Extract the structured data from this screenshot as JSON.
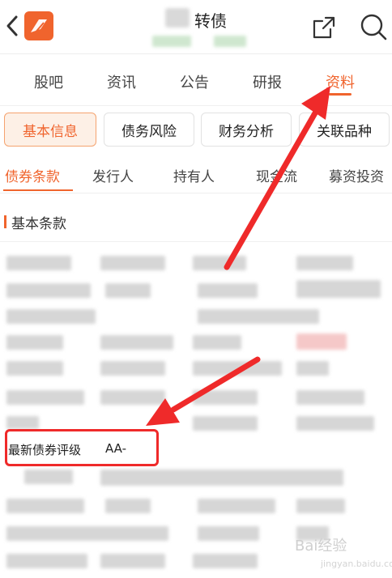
{
  "header": {
    "title_suffix": "转债",
    "icons": {
      "back": "chevron-left-icon",
      "logo": "app-logo-icon",
      "share": "share-icon",
      "search": "search-icon"
    }
  },
  "tabs_primary": [
    {
      "label": "股吧",
      "active": false
    },
    {
      "label": "资讯",
      "active": false
    },
    {
      "label": "公告",
      "active": false
    },
    {
      "label": "研报",
      "active": false
    },
    {
      "label": "资料",
      "active": true
    }
  ],
  "chips": [
    {
      "label": "基本信息",
      "active": true
    },
    {
      "label": "债务风险",
      "active": false
    },
    {
      "label": "财务分析",
      "active": false
    },
    {
      "label": "关联品种",
      "active": false
    }
  ],
  "tabs_secondary": [
    {
      "label": "债券条款",
      "active": true
    },
    {
      "label": "发行人",
      "active": false
    },
    {
      "label": "持有人",
      "active": false
    },
    {
      "label": "现金流",
      "active": false
    },
    {
      "label": "募资投资",
      "active": false
    }
  ],
  "section": {
    "title": "基本条款"
  },
  "highlight_row": {
    "label": "最新债券评级",
    "value": "AA-"
  },
  "colors": {
    "accent": "#f0642d",
    "annotation_red": "#ef2a2a"
  },
  "watermark": {
    "text": "Bai",
    "text2": "经验",
    "sub": "jingyan.baidu.com"
  }
}
